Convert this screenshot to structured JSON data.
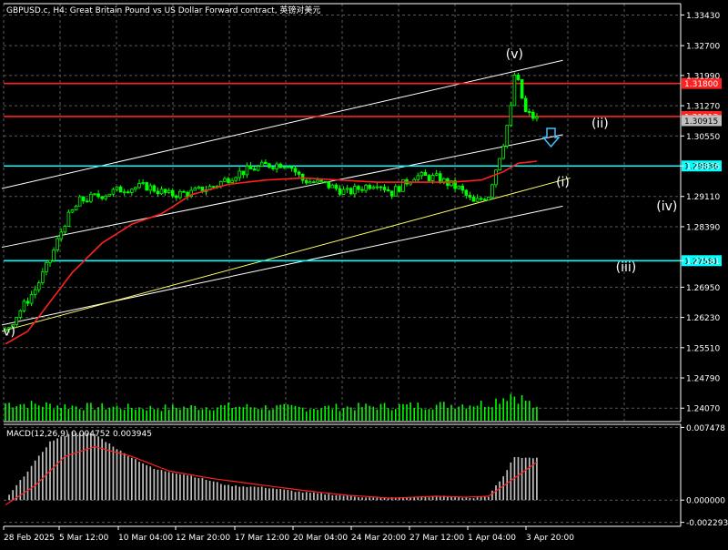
{
  "chart_title": "GBPUSD.c, H4:  Great Britain Pound vs US Dollar Forward contract, 英镑对美元",
  "macd_label": "MACD(12,26,9) 0.004752 0.003945",
  "colors": {
    "background": "#000000",
    "grid": "#5a5a5a",
    "candle_bull": "#00ff00",
    "candle_bear": "#00ff00",
    "ma": "#ff2020",
    "channel": "#ffffff",
    "trend_yellow": "#ffff66",
    "level_red": "#ff2020",
    "level_cyan": "#00ffff",
    "volume": "#00ff00",
    "macd_hist": "#c0c0c0",
    "macd_signal": "#ff2020"
  },
  "price_scale": {
    "ticks": [
      "1.33430",
      "1.32700",
      "1.31990",
      "1.31270",
      "1.30550",
      "1.29836",
      "1.29110",
      "1.28390",
      "1.27581",
      "1.26950",
      "1.26230",
      "1.25510",
      "1.24790",
      "1.24070"
    ]
  },
  "macd_scale": {
    "ticks": [
      "0.007478",
      "0.000000",
      "-0.002293"
    ]
  },
  "time_axis": {
    "labels": [
      "28 Feb 2025",
      "5 Mar 12:00",
      "10 Mar 04:00",
      "12 Mar 20:00",
      "17 Mar 12:00",
      "20 Mar 04:00",
      "24 Mar 20:00",
      "27 Mar 12:00",
      "1 Apr 04:00",
      "3 Apr 20:00"
    ]
  },
  "levels": [
    {
      "price": 1.318,
      "label": "1.31800",
      "color": "#ff2020"
    },
    {
      "price": 1.31013,
      "label": "1.31013",
      "color": "#ff2020"
    },
    {
      "price": 1.30915,
      "label": "1.30915",
      "color": "#c0c0c0"
    },
    {
      "price": 1.29836,
      "label": "1.29836",
      "color": "#00ffff"
    },
    {
      "price": 1.27581,
      "label": "1.27581",
      "color": "#00ffff"
    }
  ],
  "wave_labels": [
    {
      "text": "(v)",
      "bar": 137,
      "price": 1.324
    },
    {
      "text": "(ii)",
      "bar": 160,
      "price": 1.3075
    },
    {
      "text": "(i)",
      "bar": 150,
      "price": 1.2935
    },
    {
      "text": "(iv)",
      "bar": 178,
      "price": 1.2878
    },
    {
      "text": "(iii)",
      "bar": 167,
      "price": 1.2733
    },
    {
      "text": "v)",
      "bar": 1,
      "price": 1.258
    }
  ],
  "chart_data": {
    "type": "candlestick",
    "symbol": "GBPUSD.c",
    "timeframe": "H4",
    "price_range": [
      1.2375,
      1.337
    ],
    "macd_range": [
      -0.0027,
      0.0078
    ],
    "macd_params": "12,26,9",
    "macd_value": 0.004752,
    "macd_signal": 0.003945,
    "bar_count": 144,
    "close_path": [
      [
        0,
        1.259
      ],
      [
        4,
        1.264
      ],
      [
        8,
        1.269
      ],
      [
        12,
        1.276
      ],
      [
        16,
        1.285
      ],
      [
        20,
        1.29
      ],
      [
        26,
        1.2915
      ],
      [
        32,
        1.293
      ],
      [
        38,
        1.2935
      ],
      [
        44,
        1.2915
      ],
      [
        50,
        1.292
      ],
      [
        56,
        1.2935
      ],
      [
        62,
        1.2965
      ],
      [
        70,
        1.2985
      ],
      [
        76,
        1.299
      ],
      [
        80,
        1.295
      ],
      [
        86,
        1.294
      ],
      [
        92,
        1.292
      ],
      [
        100,
        1.2945
      ],
      [
        104,
        1.292
      ],
      [
        110,
        1.296
      ],
      [
        116,
        1.2955
      ],
      [
        122,
        1.293
      ],
      [
        126,
        1.2895
      ],
      [
        130,
        1.2915
      ],
      [
        134,
        1.304
      ],
      [
        136,
        1.312
      ],
      [
        137,
        1.32
      ],
      [
        138,
        1.318
      ],
      [
        140,
        1.311
      ],
      [
        143,
        1.3095
      ]
    ],
    "ma_path": [
      [
        0,
        1.256
      ],
      [
        6,
        1.259
      ],
      [
        12,
        1.266
      ],
      [
        18,
        1.273
      ],
      [
        26,
        1.28
      ],
      [
        34,
        1.2845
      ],
      [
        42,
        1.287
      ],
      [
        50,
        1.2915
      ],
      [
        60,
        1.294
      ],
      [
        70,
        1.295
      ],
      [
        80,
        1.2955
      ],
      [
        90,
        1.295
      ],
      [
        100,
        1.2945
      ],
      [
        110,
        1.2945
      ],
      [
        120,
        1.2945
      ],
      [
        128,
        1.295
      ],
      [
        134,
        1.297
      ],
      [
        138,
        1.299
      ],
      [
        143,
        1.2995
      ]
    ],
    "macd_hist_path": [
      [
        0,
        0.0
      ],
      [
        6,
        0.003
      ],
      [
        12,
        0.006
      ],
      [
        18,
        0.007
      ],
      [
        24,
        0.0068
      ],
      [
        32,
        0.0048
      ],
      [
        40,
        0.0032
      ],
      [
        50,
        0.0025
      ],
      [
        60,
        0.0015
      ],
      [
        70,
        0.0013
      ],
      [
        80,
        0.0008
      ],
      [
        90,
        0.0005
      ],
      [
        100,
        0.0002
      ],
      [
        110,
        0.0003
      ],
      [
        118,
        0.0004
      ],
      [
        126,
        0.0002
      ],
      [
        130,
        0.0004
      ],
      [
        134,
        0.0025
      ],
      [
        137,
        0.0045
      ],
      [
        140,
        0.0043
      ],
      [
        143,
        0.0044
      ]
    ],
    "macd_signal_path": [
      [
        0,
        -0.0005
      ],
      [
        8,
        0.0015
      ],
      [
        16,
        0.0045
      ],
      [
        24,
        0.0055
      ],
      [
        34,
        0.0045
      ],
      [
        44,
        0.003
      ],
      [
        56,
        0.0022
      ],
      [
        68,
        0.0016
      ],
      [
        80,
        0.001
      ],
      [
        92,
        0.0005
      ],
      [
        104,
        0.0002
      ],
      [
        116,
        0.0004
      ],
      [
        124,
        0.0003
      ],
      [
        130,
        0.0004
      ],
      [
        136,
        0.002
      ],
      [
        143,
        0.0039
      ]
    ],
    "volume_path": [
      [
        0,
        0.55
      ],
      [
        20,
        0.45
      ],
      [
        40,
        0.4
      ],
      [
        60,
        0.45
      ],
      [
        80,
        0.4
      ],
      [
        100,
        0.45
      ],
      [
        120,
        0.5
      ],
      [
        130,
        0.55
      ],
      [
        136,
        0.85
      ],
      [
        140,
        0.65
      ],
      [
        143,
        0.35
      ]
    ]
  }
}
